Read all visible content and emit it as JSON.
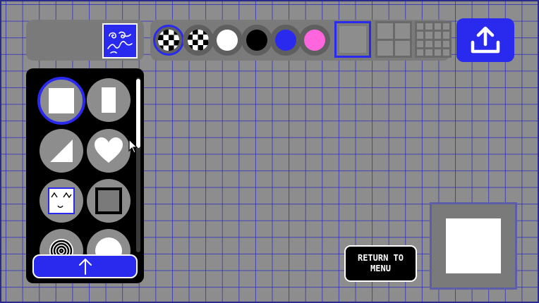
{
  "colors": {
    "background": "#8d8d8d",
    "grid_line": "#2828c8",
    "accent": "#2a2aee",
    "panel": "#7a7a7a",
    "dark_panel": "#000000"
  },
  "toolbar": {
    "swatches": [
      {
        "name": "checker-pattern-a",
        "selected": true
      },
      {
        "name": "checker-pattern-b",
        "selected": false
      },
      {
        "name": "white",
        "color": "#ffffff",
        "selected": false
      },
      {
        "name": "black",
        "color": "#000000",
        "selected": false
      },
      {
        "name": "blue",
        "color": "#2a2aee",
        "selected": false
      },
      {
        "name": "pink",
        "color": "#ff66dd",
        "selected": false
      }
    ],
    "grid_sizes": [
      {
        "name": "1x1",
        "selected": true
      },
      {
        "name": "2x2",
        "selected": false
      },
      {
        "name": "4x4",
        "selected": false
      }
    ],
    "export_icon": "upload-icon"
  },
  "shapes": [
    {
      "name": "square",
      "selected": true
    },
    {
      "name": "tall-rectangle",
      "selected": false
    },
    {
      "name": "triangle",
      "selected": false
    },
    {
      "name": "heart",
      "selected": false
    },
    {
      "name": "face-pattern",
      "selected": false
    },
    {
      "name": "outlined-square",
      "selected": false
    },
    {
      "name": "spiral",
      "selected": false
    },
    {
      "name": "circle",
      "selected": false
    }
  ],
  "scroll_up_icon": "arrow-up-icon",
  "return_button": {
    "label": "RETURN TO MENU"
  }
}
